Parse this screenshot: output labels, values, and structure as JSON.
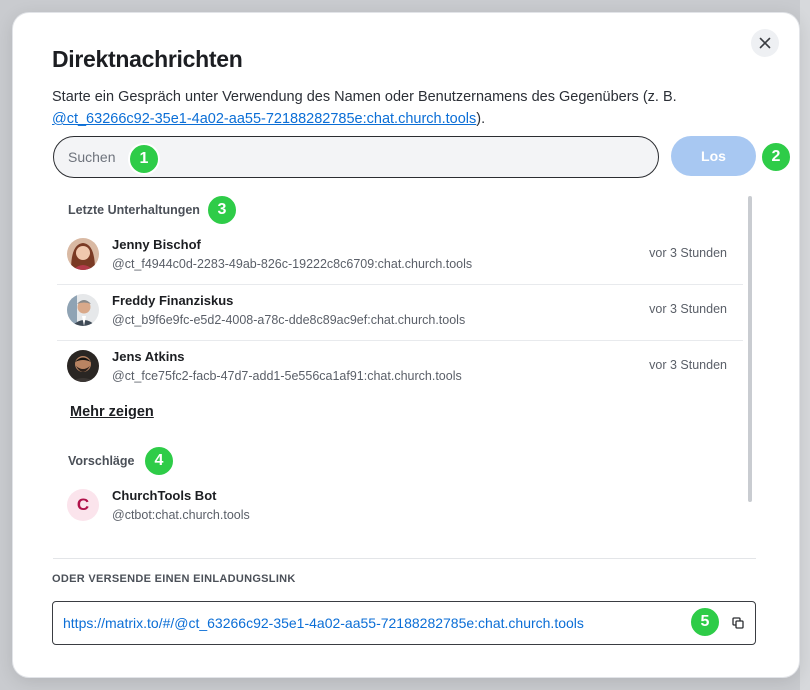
{
  "dialog": {
    "title": "Direktnachrichten",
    "subtitle_prefix": "Starte ein Gespräch unter Verwendung des Namen oder Benutzernamens des Gegenübers (z. B. ",
    "subtitle_example_id": "@ct_63266c92-35e1-4a02-aa55-72188282785e:chat.church.tools",
    "subtitle_suffix": ")."
  },
  "search": {
    "placeholder": "Suchen",
    "value": "",
    "go_label": "Los"
  },
  "recent": {
    "label": "Letzte Unterhaltungen",
    "items": [
      {
        "name": "Jenny Bischof",
        "id": "@ct_f4944c0d-2283-49ab-826c-19222c8c6709:chat.church.tools",
        "time": "vor 3 Stunden",
        "avatar": "photo-avatar"
      },
      {
        "name": "Freddy Finanziskus",
        "id": "@ct_b9f6e9fc-e5d2-4008-a78c-dde8c89ac9ef:chat.church.tools",
        "time": "vor 3 Stunden",
        "avatar": "photo-avatar"
      },
      {
        "name": "Jens Atkins",
        "id": "@ct_fce75fc2-facb-47d7-add1-5e556ca1af91:chat.church.tools",
        "time": "vor 3 Stunden",
        "avatar": "photo-avatar"
      }
    ],
    "more_label": "Mehr zeigen"
  },
  "suggestions": {
    "label": "Vorschläge",
    "items": [
      {
        "name": "ChurchTools Bot",
        "id": "@ctbot:chat.church.tools",
        "initial": "C"
      }
    ]
  },
  "invite": {
    "label": "ODER VERSENDE EINEN EINLADUNGSLINK",
    "link": "https://matrix.to/#/@ct_63266c92-35e1-4a02-aa55-72188282785e:chat.church.tools"
  },
  "badges": [
    "1",
    "2",
    "3",
    "4",
    "5"
  ],
  "colors": {
    "accent": "#0b6ed6",
    "go_button": "#a8c8f2",
    "badge": "#2ecc48",
    "bot_avatar_bg": "#fbe4ec",
    "bot_avatar_fg": "#b0124a"
  },
  "icons": {
    "close": "close-icon",
    "copy": "copy-icon"
  }
}
